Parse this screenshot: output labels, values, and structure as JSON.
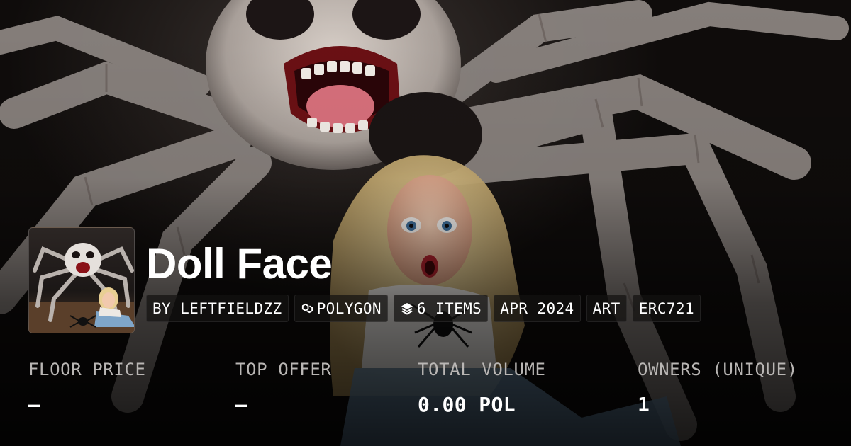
{
  "collection": {
    "title": "Doll Face",
    "tags": [
      {
        "text": "BY LEFTFIELDZZ",
        "icon": ""
      },
      {
        "text": "POLYGON",
        "icon": "polygon-chain-icon"
      },
      {
        "text": "6 ITEMS",
        "icon": "layers-icon"
      },
      {
        "text": "APR 2024",
        "icon": ""
      },
      {
        "text": "ART",
        "icon": ""
      },
      {
        "text": "ERC721",
        "icon": ""
      }
    ]
  },
  "stats": [
    {
      "label": "FLOOR PRICE",
      "value": "–"
    },
    {
      "label": "TOP OFFER",
      "value": "–"
    },
    {
      "label": "TOTAL VOLUME",
      "value": "0.00 POL"
    },
    {
      "label": "OWNERS (UNIQUE)",
      "value": "1"
    }
  ],
  "colors": {
    "background": "#0a0807",
    "text_primary": "#ffffff",
    "text_secondary": "#b9b6b4",
    "tag_background": "#141211"
  }
}
